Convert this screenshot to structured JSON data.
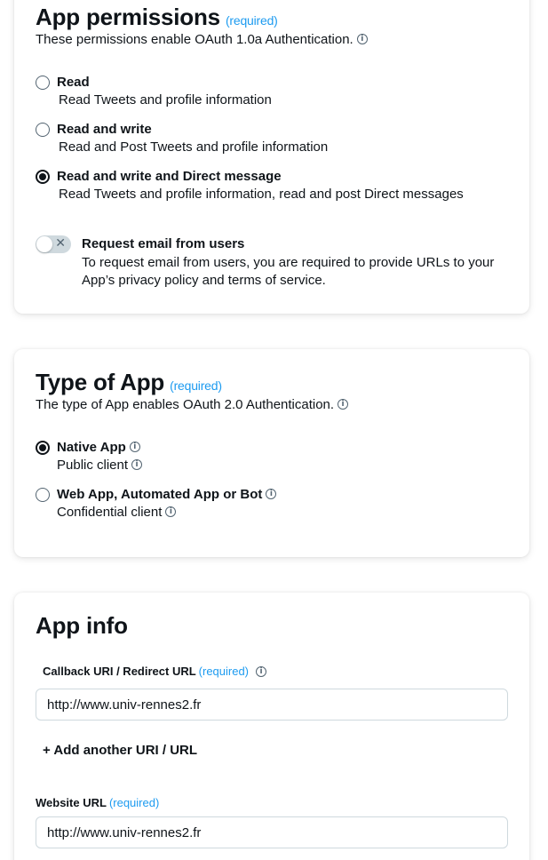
{
  "required_tag": "(required)",
  "permissions": {
    "title": "App permissions",
    "subtitle": "These permissions enable OAuth 1.0a Authentication.",
    "options": [
      {
        "label": "Read",
        "desc": "Read Tweets and profile information",
        "selected": false
      },
      {
        "label": "Read and write",
        "desc": "Read and Post Tweets and profile information",
        "selected": false
      },
      {
        "label": "Read and write and Direct message",
        "desc": "Read Tweets and profile information, read and post Direct messages",
        "selected": true
      }
    ],
    "email_toggle": {
      "title": "Request email from users",
      "desc": "To request email from users, you are required to provide URLs to your App’s privacy policy and terms of service.",
      "enabled": false
    }
  },
  "app_type": {
    "title": "Type of App",
    "subtitle": "The type of App enables OAuth 2.0 Authentication.",
    "options": [
      {
        "label": "Native App",
        "desc": "Public client",
        "selected": true
      },
      {
        "label": "Web App, Automated App or Bot",
        "desc": "Confidential client",
        "selected": false
      }
    ]
  },
  "app_info": {
    "title": "App info",
    "callback_label": "Callback URI / Redirect URL",
    "callback_value": "http://www.univ-rennes2.fr",
    "add_another": "+ Add another URI / URL",
    "website_label": "Website URL",
    "website_value": "http://www.univ-rennes2.fr"
  },
  "colors": {
    "accent": "#1d9bf0",
    "text": "#0f1419",
    "muted": "#536471",
    "border": "#cfd9de"
  }
}
